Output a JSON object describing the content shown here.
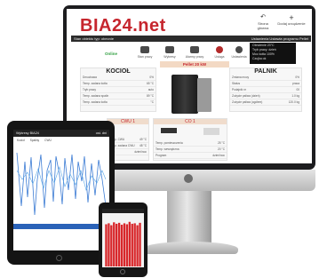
{
  "brand": {
    "logo_text": "BIA24.net",
    "accent": "#c6262e"
  },
  "monitor": {
    "top_buttons": [
      "Strona główna",
      "Dodaj urządzenie"
    ],
    "bar_left": "Stan obiektu  typ: obecnie",
    "bar_right": "Ustawienia  Ustawia programu  Pellet",
    "status_label": "Online",
    "tiles": [
      "Stan pracy",
      "Wykresy",
      "Alarmy pracy",
      "Usługa",
      "Ustawienia"
    ],
    "info_box": [
      "Obniżenie 23°C",
      "Tryb pracy:  dzień",
      "Moc kotła 100%",
      "Czujka  ok"
    ],
    "boiler_panel": {
      "title": "KOCIOŁ",
      "rows": [
        [
          "Dmuchawa",
          "0%"
        ],
        [
          "Temp. zadana kotła",
          "65 °C"
        ],
        [
          "Tryb pracy",
          "auto"
        ],
        [
          "Temp. zadana spalin",
          "89 °C"
        ],
        [
          "Temp. zadana kotła",
          "°C"
        ]
      ]
    },
    "center_label": "Pellet 20 kW",
    "burner_panel": {
      "title": "PALNIK",
      "rows": [
        [
          "Zmiana mocy",
          "0%"
        ],
        [
          "Status",
          "praca"
        ],
        [
          "Podajnik nr",
          "00"
        ],
        [
          "Zużycie paliwa (dzień)",
          "1.0 kg"
        ],
        [
          "Zużycie paliwa (ogółem)",
          "120.0 kg"
        ]
      ]
    },
    "cwu_panel": {
      "title": "CWU 1",
      "rows": [
        [
          "Temp. CWU",
          "49 °C"
        ],
        [
          "Temp. zadana CWU",
          "48 °C"
        ],
        [
          "Tryb",
          "dzień/noc"
        ]
      ]
    },
    "co_panel": {
      "title": "CO 1",
      "rows": [
        [
          "Temp. pomieszczenia",
          "25 °C"
        ],
        [
          "Temp. wewnętrzna",
          "20 °C"
        ],
        [
          "Program",
          "dzień/noc"
        ]
      ]
    }
  },
  "tablet": {
    "header_left": "Wykresy BIA24",
    "header_right": "ost. dni",
    "legend": [
      "Kocioł",
      "Spaliny",
      "CWU"
    ]
  },
  "phone": {
    "bars": [
      88,
      90,
      86,
      92,
      89,
      91,
      87,
      90,
      88,
      93,
      89,
      90,
      86,
      91
    ]
  }
}
